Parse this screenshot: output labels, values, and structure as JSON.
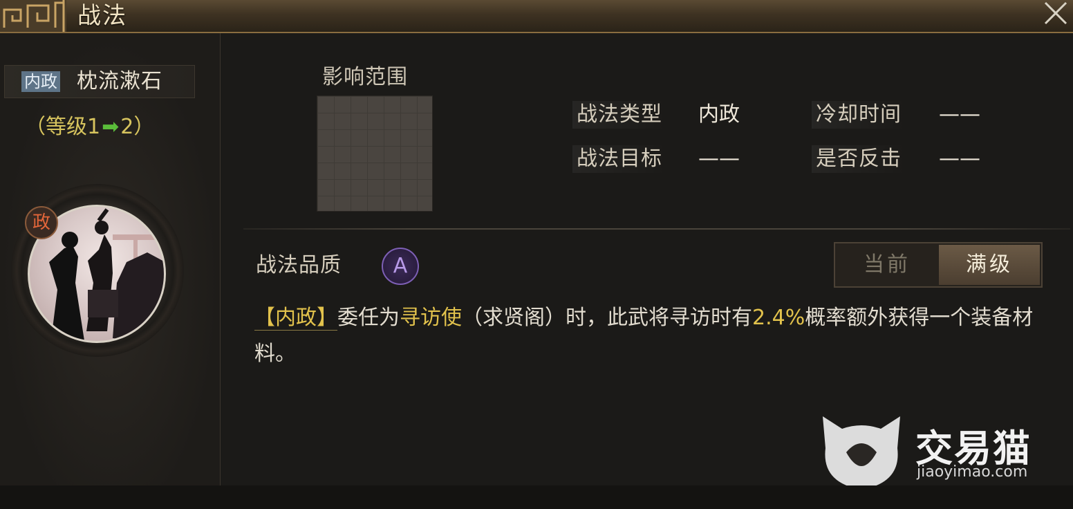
{
  "header": {
    "title": "战法",
    "close_icon": "close-icon"
  },
  "left": {
    "type_tag": "内政",
    "skill_name": "枕流漱石",
    "level_prefix": "（等级1",
    "level_arrow": "➡",
    "level_suffix": "2）",
    "faction_badge": "政"
  },
  "main": {
    "range_label": "影响范围",
    "info": {
      "type_label": "战法类型",
      "type_value": "内政",
      "cooldown_label": "冷却时间",
      "cooldown_value": "——",
      "target_label": "战法目标",
      "target_value": "——",
      "counter_label": "是否反击",
      "counter_value": "——"
    },
    "quality_label": "战法品质",
    "quality_grade": "A",
    "toggle": {
      "current": "当前",
      "max": "满级",
      "selected": "max"
    },
    "description": {
      "tag": "【内政】",
      "part1": "委任为",
      "role": "寻访使",
      "part2": "（求贤阁）时，此武将寻访时有",
      "chance": "2.4%",
      "part3": "概率额外获得一个装备材料。"
    }
  },
  "watermark": {
    "brand": "交易猫",
    "url": "jiaoyimao.com"
  },
  "colors": {
    "title_text": "#f0e2c2",
    "highlight": "#e2c24c",
    "tag_blue": "#5e7488",
    "arrow_green": "#5bbd3a",
    "quality_purple": "#7d5fb5"
  }
}
